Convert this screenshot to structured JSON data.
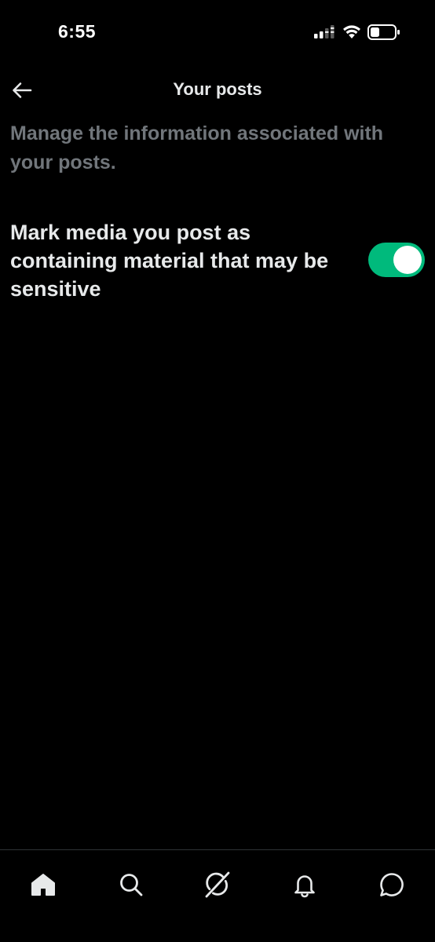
{
  "status_bar": {
    "time": "6:55",
    "icons": [
      "signal-icon",
      "wifi-icon",
      "battery-icon"
    ]
  },
  "header": {
    "title": "Your posts",
    "back_icon": "arrow-left-icon"
  },
  "description": "Manage the information associated with your posts.",
  "settings": [
    {
      "label": "Mark media you post as containing material that may be sensitive",
      "enabled": true
    }
  ],
  "bottom_nav": {
    "items": [
      {
        "icon": "home-icon",
        "active": true
      },
      {
        "icon": "search-icon",
        "active": false
      },
      {
        "icon": "grok-icon",
        "active": false
      },
      {
        "icon": "bell-icon",
        "active": false
      },
      {
        "icon": "chat-icon",
        "active": false
      }
    ]
  },
  "colors": {
    "background": "#000000",
    "text_primary": "#e7e9ea",
    "text_secondary": "#71767b",
    "toggle_on": "#00ba7c",
    "divider": "#2f3336"
  }
}
